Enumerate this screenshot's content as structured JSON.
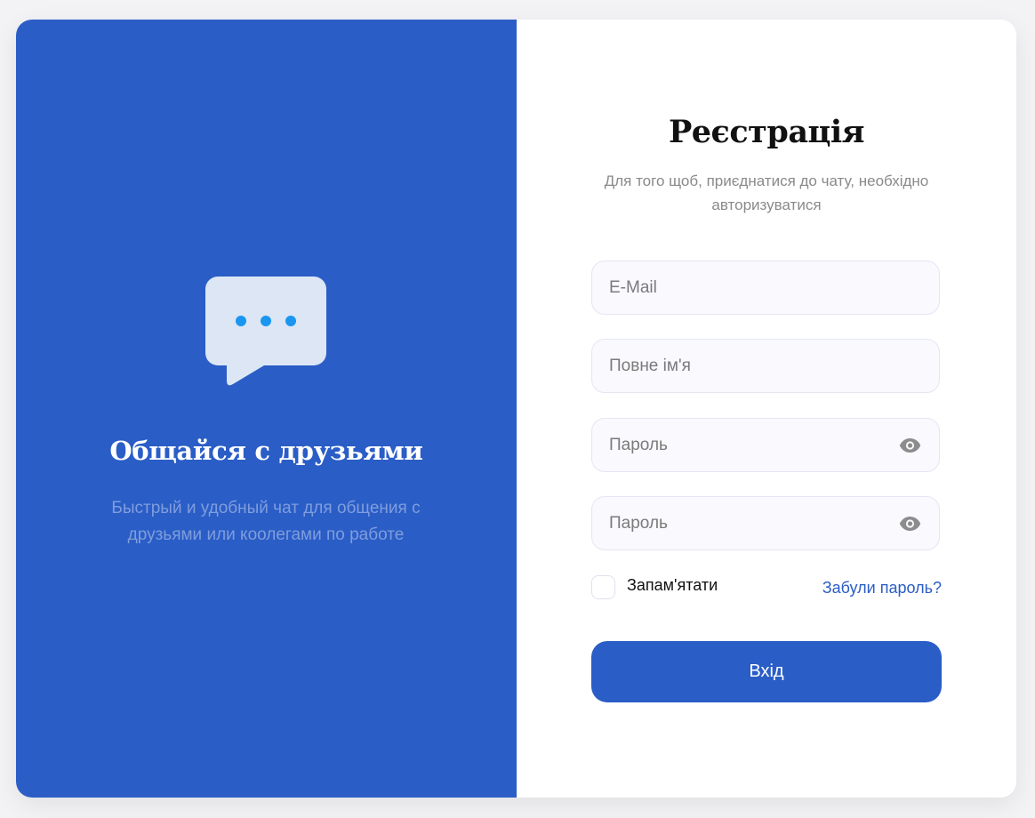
{
  "promo": {
    "icon": "chat-bubble-icon",
    "title": "Общайся с друзьями",
    "subtitle": "Быстрый и удобный чат для общения с друзьями или коолегами по работе"
  },
  "form": {
    "title": "Реєстрація",
    "subtitle": "Для того щоб, приєднатися до чату, необхідно авторизуватися",
    "email_placeholder": "E-Mail",
    "fullname_placeholder": "Повне ім'я",
    "password_placeholder": "Пароль",
    "password_confirm_placeholder": "Пароль",
    "remember_label": "Запам'ятати",
    "forgot_link": "Забули пароль?",
    "submit_label": "Вхід"
  },
  "colors": {
    "brand": "#2a5dc6",
    "bubble": "#dce6f4",
    "bubble_dots": "#1a96f0"
  }
}
